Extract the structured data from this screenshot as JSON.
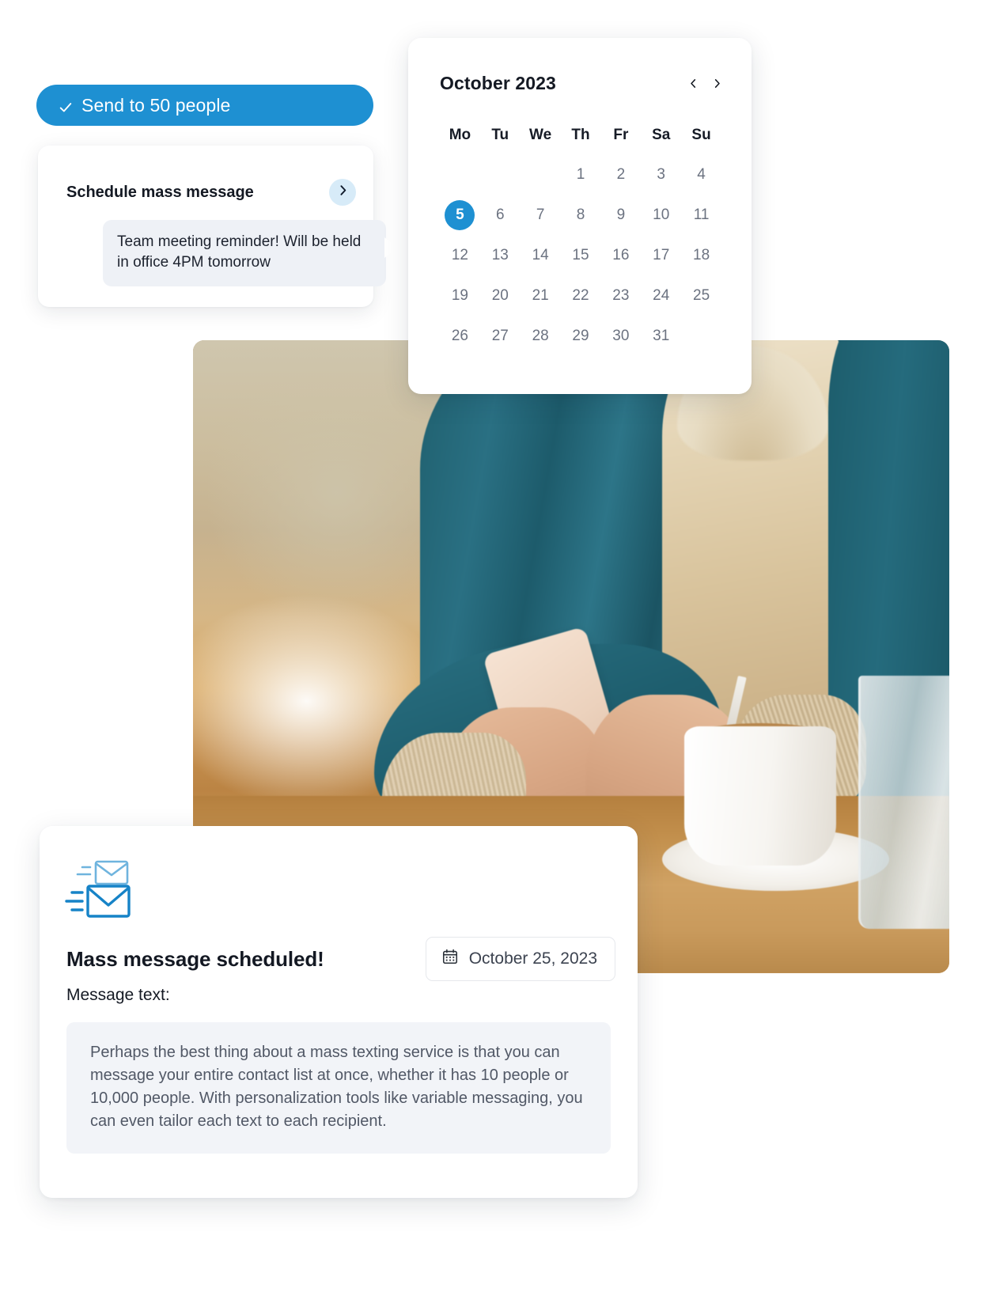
{
  "accent_color": "#1e90d2",
  "send_pill": {
    "label": "Send to 50 people",
    "icon": "check-icon"
  },
  "schedule_card": {
    "title": "Schedule mass message",
    "chevron_icon": "chevron-right-icon",
    "message_preview": "Team meeting reminder! Will be held in office 4PM tomorrow"
  },
  "calendar": {
    "title": "October 2023",
    "prev_icon": "chevron-left-icon",
    "next_icon": "chevron-right-icon",
    "weekdays": [
      "Mo",
      "Tu",
      "We",
      "Th",
      "Fr",
      "Sa",
      "Su"
    ],
    "leading_blanks": 3,
    "days": [
      1,
      2,
      3,
      4,
      5,
      6,
      7,
      8,
      9,
      10,
      11,
      12,
      13,
      14,
      15,
      16,
      17,
      18,
      19,
      20,
      21,
      22,
      23,
      24,
      25,
      26,
      27,
      28,
      29,
      30,
      31
    ],
    "selected_day": 5
  },
  "photo": {
    "alt": "person in teal cardigan using a smartphone at a cafe table with coffee cup and glass of water"
  },
  "confirmation_card": {
    "icon": "mass-mail-icon",
    "title": "Mass message scheduled!",
    "date_badge": {
      "icon": "calendar-icon",
      "label": "October 25, 2023"
    },
    "message_label": "Message text:",
    "message_body": "Perhaps the best thing about a mass texting service is that you can message your entire contact list at once, whether it has 10 people or 10,000 people. With personalization tools like variable messaging, you can even tailor each text to each recipient."
  }
}
